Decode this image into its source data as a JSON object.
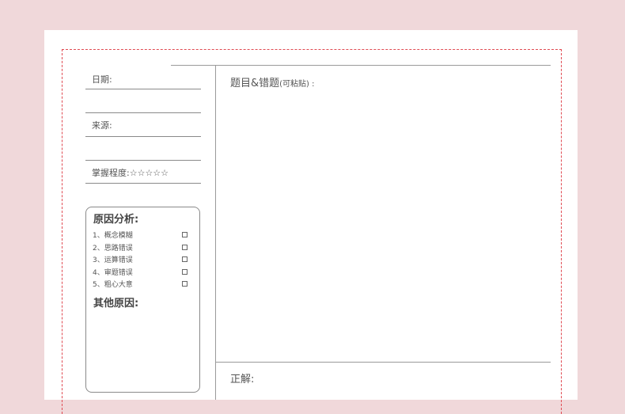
{
  "left_panel": {
    "date_label": "日期:",
    "source_label": "来源:",
    "mastery_label": "掌握程度:",
    "mastery_stars": "☆☆☆☆☆"
  },
  "reason_box": {
    "title": "原因分析:",
    "items": [
      {
        "label": "1、概念模糊"
      },
      {
        "label": "2、思路错误"
      },
      {
        "label": "3、运算错误"
      },
      {
        "label": "4、审题错误"
      },
      {
        "label": "5、粗心大意"
      }
    ],
    "other_title": "其他原因:"
  },
  "question": {
    "label": "题目&错题",
    "hint": "(可粘贴) :"
  },
  "answer": {
    "label": "正解:"
  },
  "colors": {
    "background": "#f0d8da",
    "paper": "#ffffff",
    "dashed_border": "#e04a52",
    "rule": "#9a9a9a"
  }
}
